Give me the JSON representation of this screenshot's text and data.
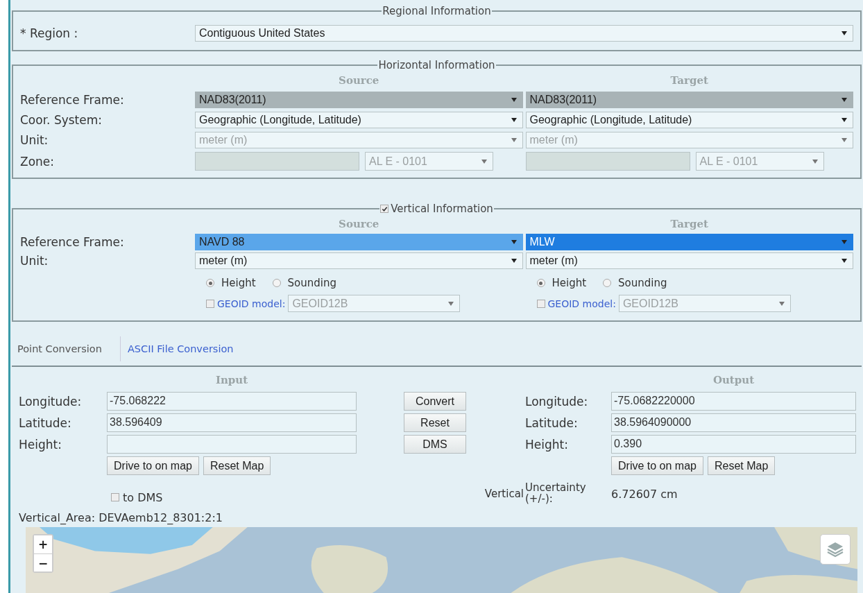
{
  "regional": {
    "legend": "Regional Information",
    "label": "* Region :",
    "select": {
      "value": "Contiguous United States",
      "kind": "plain"
    }
  },
  "horizontal": {
    "legend": "Horizontal Information",
    "source_heading": "Source",
    "target_heading": "Target",
    "rows": [
      {
        "kind": "select",
        "label": "Reference Frame:",
        "source": {
          "value": "NAD83(2011)",
          "kind": "shaded"
        },
        "target": {
          "value": "NAD83(2011)",
          "kind": "shaded"
        }
      },
      {
        "kind": "select",
        "label": "Coor. System:",
        "source": {
          "value": "Geographic (Longitude, Latitude)",
          "kind": "plain"
        },
        "target": {
          "value": "Geographic (Longitude, Latitude)",
          "kind": "plain"
        }
      },
      {
        "kind": "select",
        "label": "Unit:",
        "source": {
          "value": "meter (m)",
          "kind": "faded"
        },
        "target": {
          "value": "meter (m)",
          "kind": "faded"
        }
      },
      {
        "kind": "zone",
        "label": "Zone:",
        "source": {
          "value": "AL E - 0101",
          "kind": "faded"
        },
        "target": {
          "value": "AL E - 0101",
          "kind": "faded"
        }
      }
    ]
  },
  "vertical": {
    "legend": "Vertical Information",
    "checked": true,
    "source_heading": "Source",
    "target_heading": "Target",
    "rows": [
      {
        "kind": "select",
        "label": "Reference Frame:",
        "source": {
          "value": "NAVD 88",
          "kind": "hover"
        },
        "target": {
          "value": "MLW",
          "kind": "focus"
        }
      },
      {
        "kind": "select",
        "label": "Unit:",
        "source": {
          "value": "meter (m)",
          "kind": "plain"
        },
        "target": {
          "value": "meter (m)",
          "kind": "plain"
        }
      }
    ],
    "options": [
      {
        "radios": [
          {
            "label": "Height",
            "selected": true
          },
          {
            "label": "Sounding",
            "selected": false
          }
        ],
        "geoid": {
          "label": "GEOID model:",
          "checked": false,
          "value": "GEOID12B"
        }
      },
      {
        "radios": [
          {
            "label": "Height",
            "selected": true
          },
          {
            "label": "Sounding",
            "selected": false
          }
        ],
        "geoid": {
          "label": "GEOID model:",
          "checked": false,
          "value": "GEOID12B"
        }
      }
    ]
  },
  "tabs": [
    {
      "label": "Point Conversion",
      "selected": true
    },
    {
      "label": "ASCII File Conversion",
      "selected": false
    }
  ],
  "conversion": {
    "input_heading": "Input",
    "output_heading": "Output",
    "inputs": [
      {
        "label": "Longitude:",
        "value": "-75.068222"
      },
      {
        "label": "Latitude:",
        "value": "38.596409"
      },
      {
        "label": "Height:"
      }
    ],
    "actions": [
      "Convert",
      "Reset",
      "DMS"
    ],
    "outputs": [
      {
        "label": "Longitude:",
        "value": "-75.0682220000"
      },
      {
        "label": "Latitude:",
        "value": "38.5964090000"
      },
      {
        "label": "Height:",
        "value": "0.390"
      }
    ],
    "input_map_buttons": [
      "Drive to on map",
      "Reset Map"
    ],
    "output_map_buttons": [
      "Drive to on map",
      "Reset Map"
    ],
    "to_dms": {
      "label": "to DMS",
      "checked": false
    },
    "uncertainty": {
      "prefix": "Vertical",
      "label": "Uncertainty (+/-):",
      "value": "6.72607 cm"
    },
    "vertical_area": "Vertical_Area: DEVAemb12_8301:2:1"
  },
  "map": {
    "zoom_buttons": [
      "+",
      "−"
    ]
  }
}
